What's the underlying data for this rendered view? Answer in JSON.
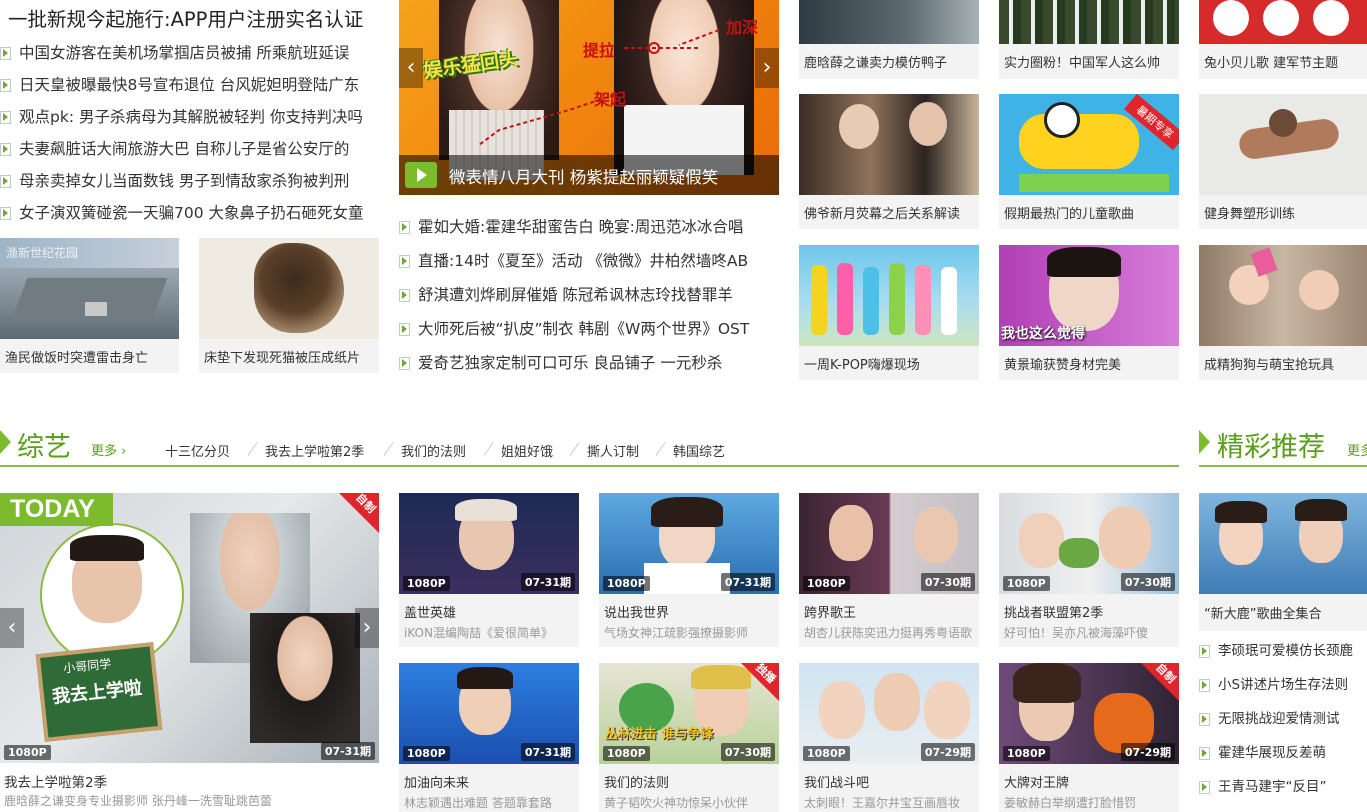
{
  "headline": "一批新规今起施行:APP用户注册实名认证",
  "left_news": [
    "中国女游客在美机场掌掴店员被捕 所乘航班延误",
    "日天皇被曝最快8号宣布退位  台风妮妲明登陆广东",
    "观点pk:  男子杀病母为其解脱被轻判 你支持判决吗",
    "夫妻飙脏话大闹旅游大巴 自称儿子是省公安厅的",
    "母亲卖掉女儿当面数钱  男子到情敌家杀狗被判刑",
    "女子演双簧碰瓷一天骗700  大象鼻子扔石砸死女童"
  ],
  "left_thumbs": [
    {
      "caption": "渔民做饭时突遭雷击身亡",
      "image_text": "渔新世纪花园"
    },
    {
      "caption": "床垫下发现死猫被压成纸片"
    }
  ],
  "banner": {
    "caption": "微表情八月大刊 杨紫提赵丽颖疑假笑",
    "logo": "娱乐猛回头",
    "labels": [
      "加深",
      "提拉",
      "架起"
    ]
  },
  "mid_news": [
    "霍如大婚:霍建华甜蜜告白  晚宴:周迅范冰冰合唱",
    "直播:14时《夏至》活动  《微微》井柏然墙咚AB",
    "舒淇遭刘烨刷屏催婚  陈冠希讽林志玲找替罪羊",
    "大师死后被“扒皮”制衣  韩剧《W两个世界》OST",
    "爱奇艺独家定制可口可乐  良品铺子 一元秒杀"
  ],
  "grid_top": [
    {
      "caption": "鹿晗薛之谦卖力模仿鸭子"
    },
    {
      "caption": "实力圈粉！中国军人这么帅"
    },
    {
      "caption": "兔小贝儿歌 建军节主题"
    },
    {
      "caption": "佛爷新月荧幕之后关系解读"
    },
    {
      "caption": "假期最热门的儿童歌曲",
      "tag": "暑期专享"
    },
    {
      "caption": "健身舞塑形训练"
    },
    {
      "caption": "一周K-POP嗨爆现场"
    },
    {
      "caption": "黄景瑜获赞身材完美",
      "overlay": "我也这么觉得"
    },
    {
      "caption": "成精狗狗与萌宝抢玩具"
    }
  ],
  "variety": {
    "title": "综艺",
    "more": "更多",
    "tags": [
      "十三亿分贝",
      "我去上学啦第2季",
      "我们的法则",
      "姐姐好饿",
      "撕人订制",
      "韩国综艺"
    ],
    "feature": {
      "today": "TODAY",
      "corner": "自制",
      "logo": "我去上学啦",
      "logo_small": "小哥同学",
      "quality": "1080P",
      "date": "07-31期",
      "title": "我去上学啦第2季",
      "desc": "鹿晗薛之谦变身专业摄影师 张丹峰一洗雪耻跳芭蕾"
    },
    "items": [
      {
        "title": "盖世英雄",
        "desc": "iKON混编陶喆《爱很简单》",
        "quality": "1080P",
        "date": "07-31期"
      },
      {
        "title": "说出我世界",
        "desc": "气场女神江疏影强撩摄影师",
        "quality": "1080P",
        "date": "07-31期"
      },
      {
        "title": "跨界歌王",
        "desc": "胡杏儿获陈奕迅力挺再秀粤语歌",
        "quality": "1080P",
        "date": "07-30期"
      },
      {
        "title": "挑战者联盟第2季",
        "desc": "好可怕！吴亦凡被海藻吓傻",
        "quality": "1080P",
        "date": "07-30期"
      },
      {
        "title": "加油向未来",
        "desc": "林志颖遇出难题 答题靠套路",
        "quality": "1080P",
        "date": "07-31期"
      },
      {
        "title": "我们的法则",
        "desc": "黄子韬吹火神功惊呆小伙伴",
        "quality": "1080P",
        "date": "07-30期",
        "corner": "独播",
        "overlay": "丛林进击  谁与争锋"
      },
      {
        "title": "我们战斗吧",
        "desc": "太刺眼！王嘉尔井宝互画唇妆",
        "quality": "1080P",
        "date": "07-29期"
      },
      {
        "title": "大牌对王牌",
        "desc": "姜敏赫白举纲遭打脸惜罚",
        "quality": "1080P",
        "date": "07-29期",
        "corner": "自制"
      }
    ]
  },
  "recommend": {
    "title": "精彩推荐",
    "more": "更多",
    "top_caption": "“新大鹿”歌曲全集合",
    "list": [
      "李硕珉可爱模仿长颈鹿",
      "小S讲述片场生存法则",
      "无限挑战迎爱情测试",
      "霍建华展现反差萌",
      "王青马建宇“反目”"
    ]
  },
  "colors": {
    "accent": "#7cbc2c",
    "accent_dark": "#5a9e1a",
    "badge": "#e0262b",
    "caption_bg": "#f3f3f3"
  }
}
